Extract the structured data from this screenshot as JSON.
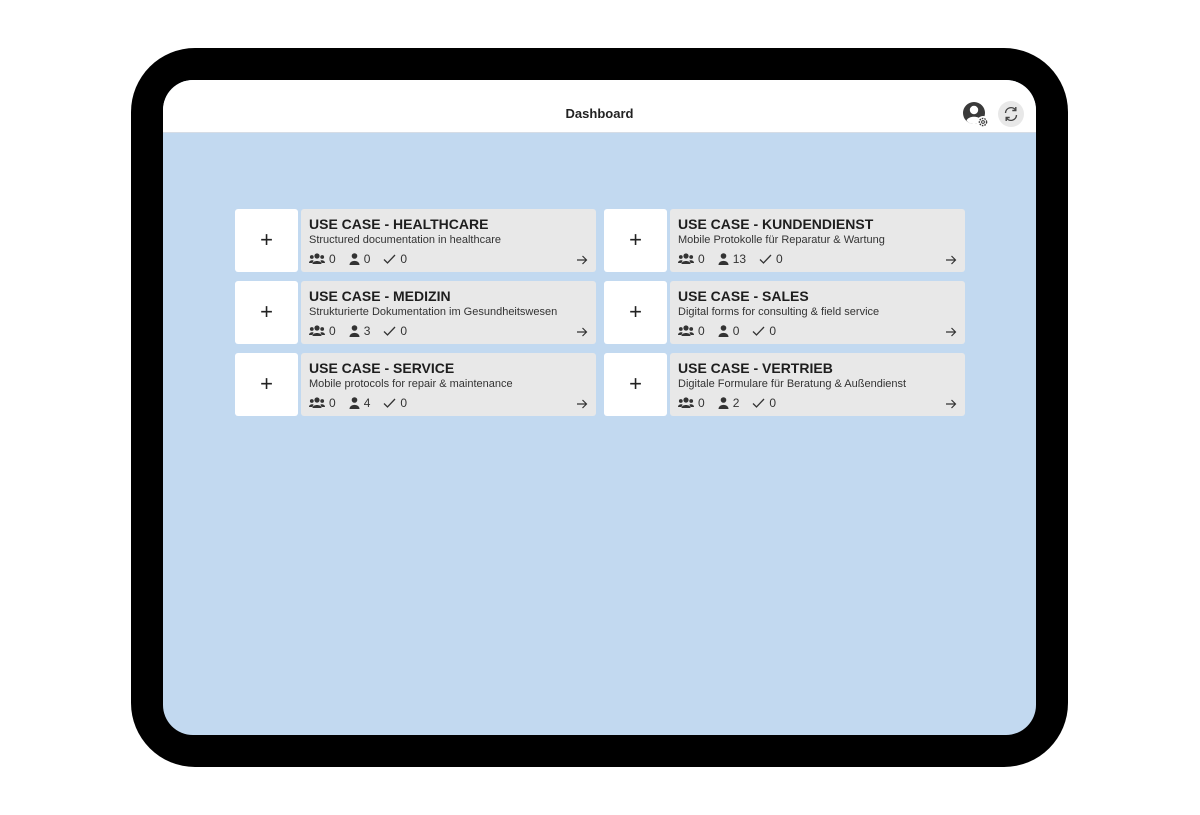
{
  "header": {
    "title": "Dashboard"
  },
  "use_cases": [
    {
      "title": "USE CASE - HEALTHCARE",
      "description": "Structured documentation in healthcare",
      "groups": "0",
      "users": "0",
      "done": "0"
    },
    {
      "title": "USE CASE - KUNDENDIENST",
      "description": "Mobile Protokolle für Reparatur & Wartung",
      "groups": "0",
      "users": "13",
      "done": "0"
    },
    {
      "title": "USE CASE - MEDIZIN",
      "description": "Strukturierte Dokumentation im Gesundheitswesen",
      "groups": "0",
      "users": "3",
      "done": "0"
    },
    {
      "title": "USE CASE - SALES",
      "description": "Digital forms for consulting & field service",
      "groups": "0",
      "users": "0",
      "done": "0"
    },
    {
      "title": "USE CASE - SERVICE",
      "description": "Mobile protocols for repair & maintenance",
      "groups": "0",
      "users": "4",
      "done": "0"
    },
    {
      "title": "USE CASE - VERTRIEB",
      "description": "Digitale Formulare für Beratung & Außendienst",
      "groups": "0",
      "users": "2",
      "done": "0"
    }
  ],
  "add_label": "+",
  "icons": {
    "profile": "profile-settings-icon",
    "sync": "sync-icon",
    "groups": "group-icon",
    "users": "user-icon",
    "done": "check-icon",
    "open": "arrow-right-icon"
  },
  "colors": {
    "background": "#c2d9f0",
    "card": "#e8e8e8",
    "device_frame": "#000000"
  }
}
